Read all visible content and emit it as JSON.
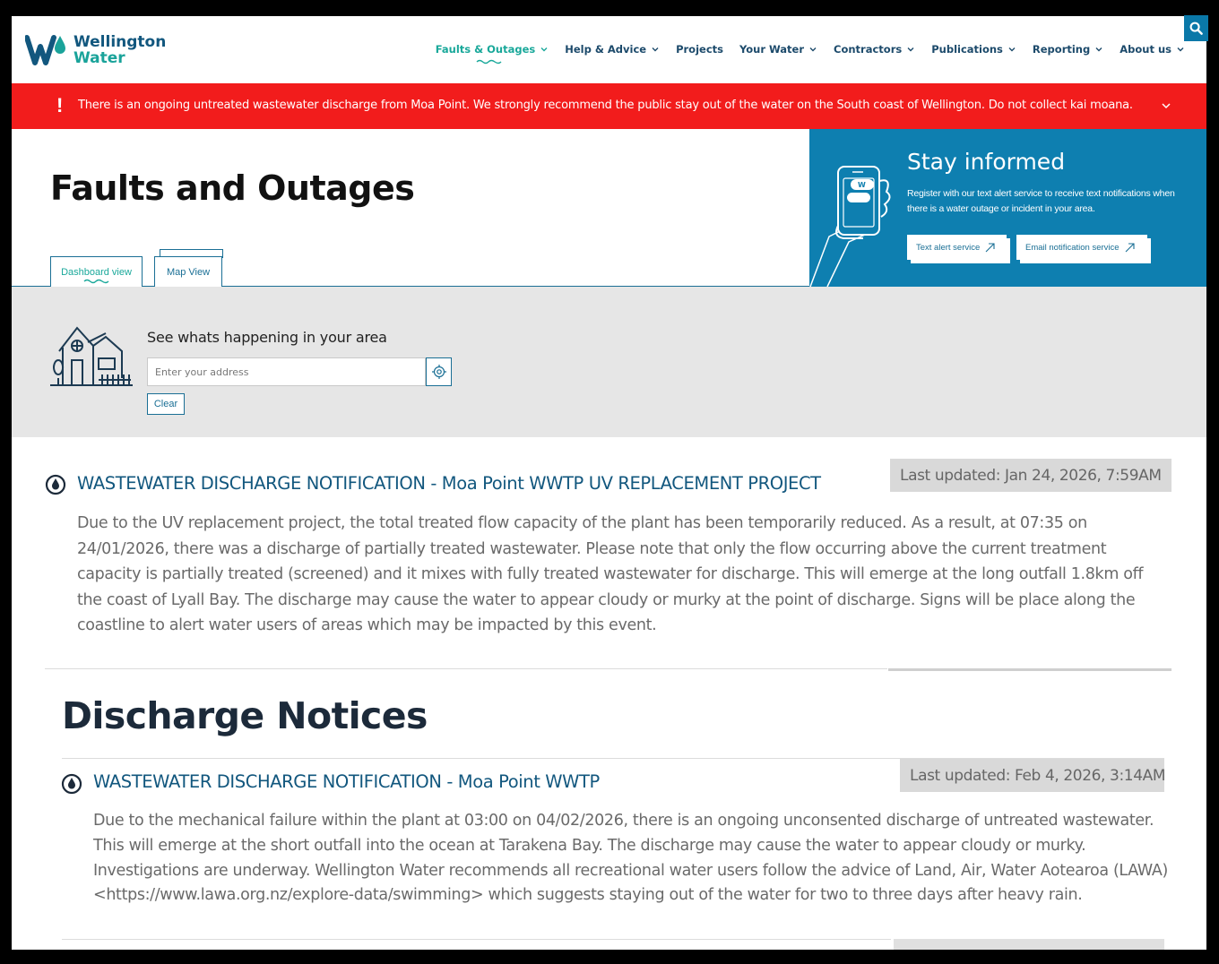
{
  "header": {
    "logo_line1": "Wellington",
    "logo_line2": "Water",
    "nav": [
      {
        "label": "Faults & Outages",
        "active": true,
        "dropdown": true
      },
      {
        "label": "Help & Advice",
        "dropdown": true
      },
      {
        "label": "Projects",
        "dropdown": false
      },
      {
        "label": "Your Water",
        "dropdown": true
      },
      {
        "label": "Contractors",
        "dropdown": true
      },
      {
        "label": "Publications",
        "dropdown": true
      },
      {
        "label": "Reporting",
        "dropdown": true
      },
      {
        "label": "About us",
        "dropdown": true
      }
    ],
    "search_icon": "search-icon"
  },
  "alert": {
    "text": "There is an ongoing untreated wastewater discharge from Moa Point. We strongly recommend the public stay out of the water on the South coast of Wellington. Do not collect kai moana.",
    "color": "#f21c1c"
  },
  "hero": {
    "title": "Faults and Outages",
    "tabs": [
      "Dashboard view",
      "Map View"
    ],
    "stay_title": "Stay informed",
    "stay_body": "Register with our text alert service to receive text notifications when there is a water outage or incident in your area.",
    "text_alert_label": "Text alert service",
    "email_label": "Email notification service"
  },
  "search": {
    "heading": "See whats happening in your area",
    "placeholder": "Enter your address",
    "clear_label": "Clear"
  },
  "notices": [
    {
      "title": "WASTEWATER DISCHARGE NOTIFICATION - Moa Point WWTP UV REPLACEMENT PROJECT",
      "updated": "Last updated: Jan 24, 2026, 7:59AM",
      "body": "Due to the UV replacement project, the total treated flow capacity of the plant has been temporarily reduced. As a result, at 07:35 on 24/01/2026, there was a discharge of partially treated wastewater. Please note that only the flow occurring above the current treatment capacity is partially treated (screened) and it mixes with fully treated wastewater for discharge. This will emerge at the long outfall 1.8km off the coast of Lyall Bay. The discharge may cause the water to appear cloudy or murky at the point of discharge. Signs will be place along the coastline to alert water users of areas which may be impacted by this event."
    }
  ],
  "discharge": {
    "section_title": "Discharge Notices",
    "items": [
      {
        "title": "WASTEWATER DISCHARGE NOTIFICATION - Moa Point WWTP",
        "updated": "Last updated: Feb 4, 2026, 3:14AM",
        "body": "Due to the mechanical failure within the plant at 03:00 on 04/02/2026, there is an ongoing unconsented discharge of untreated wastewater. This will emerge at the short outfall into the ocean at Tarakena Bay. The discharge may cause the water to appear cloudy or murky. Investigations are underway. Wellington Water recommends all recreational water users follow the advice of Land, Air, Water Aotearoa (LAWA) <https://www.lawa.org.nz/explore-data/swimming> which suggests staying out of the water for two to three days after heavy rain."
      }
    ]
  },
  "colors": {
    "brand_blue": "#12577e",
    "brand_teal": "#19a89a",
    "hero_blue": "#0e7fb0"
  }
}
